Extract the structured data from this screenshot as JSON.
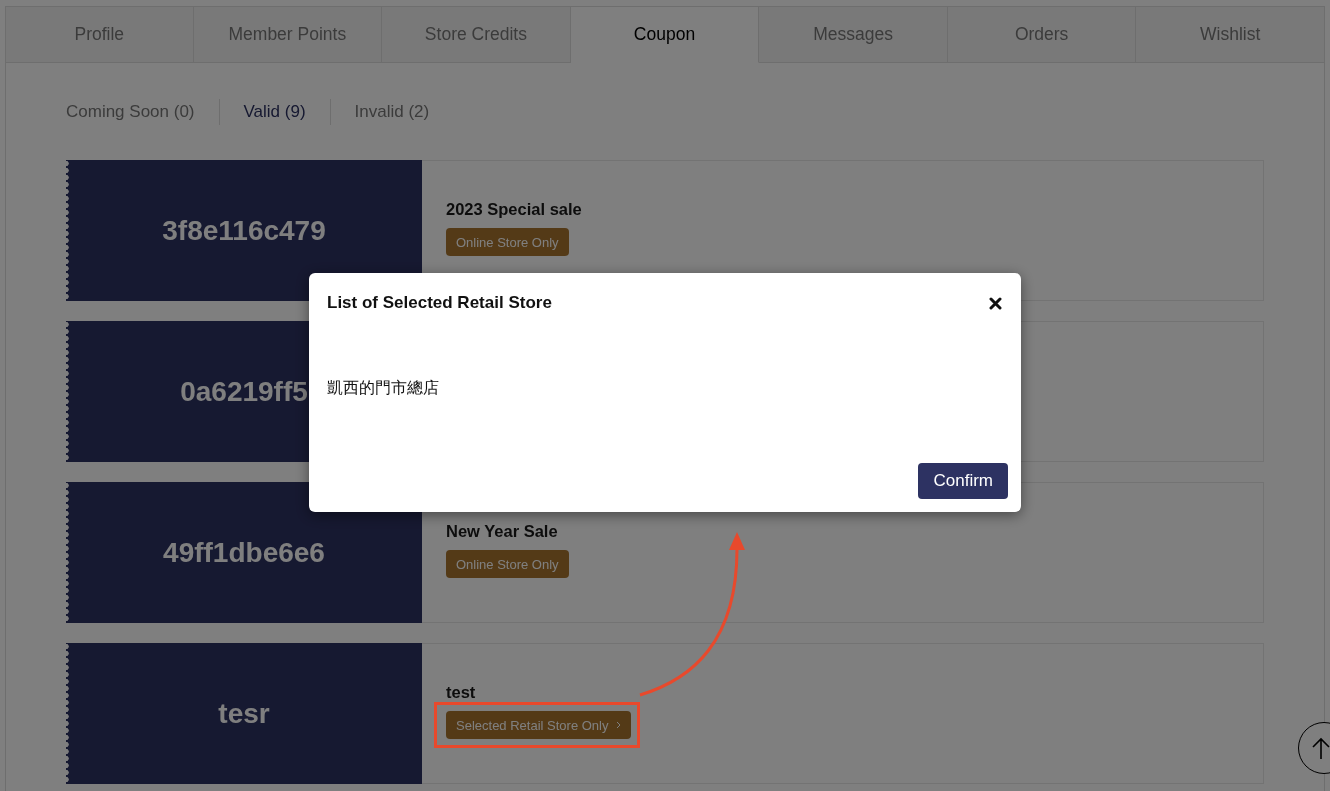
{
  "tabs": [
    {
      "label": "Profile",
      "selected": false
    },
    {
      "label": "Member Points",
      "selected": false
    },
    {
      "label": "Store Credits",
      "selected": false
    },
    {
      "label": "Coupon",
      "selected": true
    },
    {
      "label": "Messages",
      "selected": false
    },
    {
      "label": "Orders",
      "selected": false
    },
    {
      "label": "Wishlist",
      "selected": false
    }
  ],
  "coupon_filters": [
    {
      "label": "Coming Soon (0)",
      "selected": false
    },
    {
      "label": "Valid (9)",
      "selected": true
    },
    {
      "label": "Invalid (2)",
      "selected": false
    }
  ],
  "coupons": [
    {
      "code": "3f8e116c479",
      "title": "2023 Special sale",
      "badge": {
        "label": "Online Store Only",
        "kind": "plain"
      },
      "highlighted": false
    },
    {
      "code": "0a6219ff5",
      "highlighted": false
    },
    {
      "code": "49ff1dbe6e6",
      "title": "New Year Sale",
      "badge": {
        "label": "Online Store Only",
        "kind": "plain"
      },
      "highlighted": false
    },
    {
      "code": "tesr",
      "title": "test",
      "badge": {
        "label": "Selected Retail Store Only",
        "kind": "link"
      },
      "highlighted": true
    }
  ],
  "modal": {
    "title": "List of Selected Retail Store",
    "stores": [
      "凱西的門市總店"
    ],
    "confirm_label": "Confirm"
  }
}
